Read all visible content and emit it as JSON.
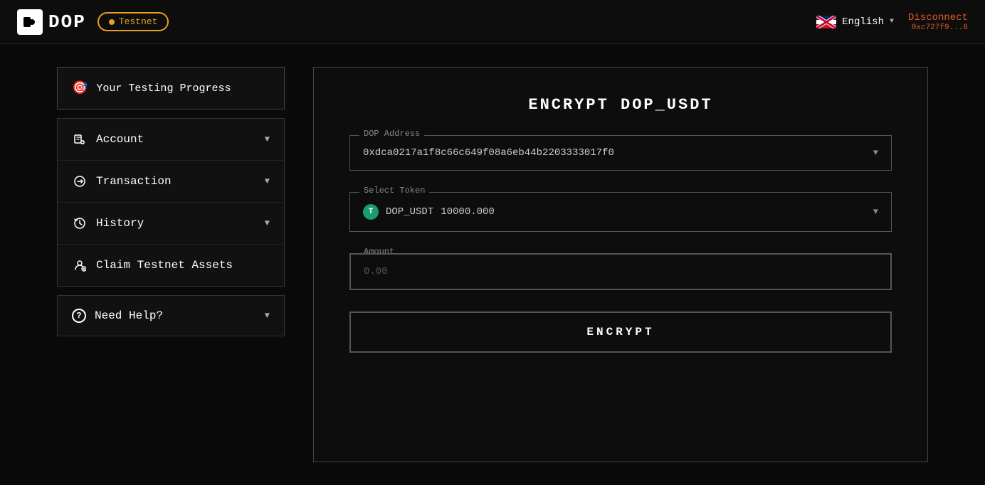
{
  "header": {
    "logo_text": "DOP",
    "testnet_label": "Testnet",
    "language": "English",
    "disconnect_label": "Disconnect",
    "wallet_address": "0xc727f9...6"
  },
  "sidebar": {
    "progress_label": "Your Testing Progress",
    "items": [
      {
        "id": "account",
        "label": "Account",
        "icon": "🔒",
        "has_chevron": true
      },
      {
        "id": "transaction",
        "label": "Transaction",
        "icon": "↔",
        "has_chevron": true
      },
      {
        "id": "history",
        "label": "History",
        "icon": "🕐",
        "has_chevron": true
      },
      {
        "id": "claim",
        "label": "Claim Testnet Assets",
        "icon": "👤",
        "has_chevron": false
      }
    ],
    "help_label": "Need Help?",
    "help_icon": "?"
  },
  "main": {
    "title": "ENCRYPT DOP_USDT",
    "dop_address_label": "DOP Address",
    "dop_address_value": "0xdca0217a1f8c66c649f08a6eb44b2203333017f0",
    "select_token_label": "Select Token",
    "token_symbol": "T",
    "token_name": "DOP_USDT",
    "token_amount": "10000.000",
    "amount_label": "Amount",
    "amount_placeholder": "0.00",
    "encrypt_button": "ENCRYPT"
  }
}
